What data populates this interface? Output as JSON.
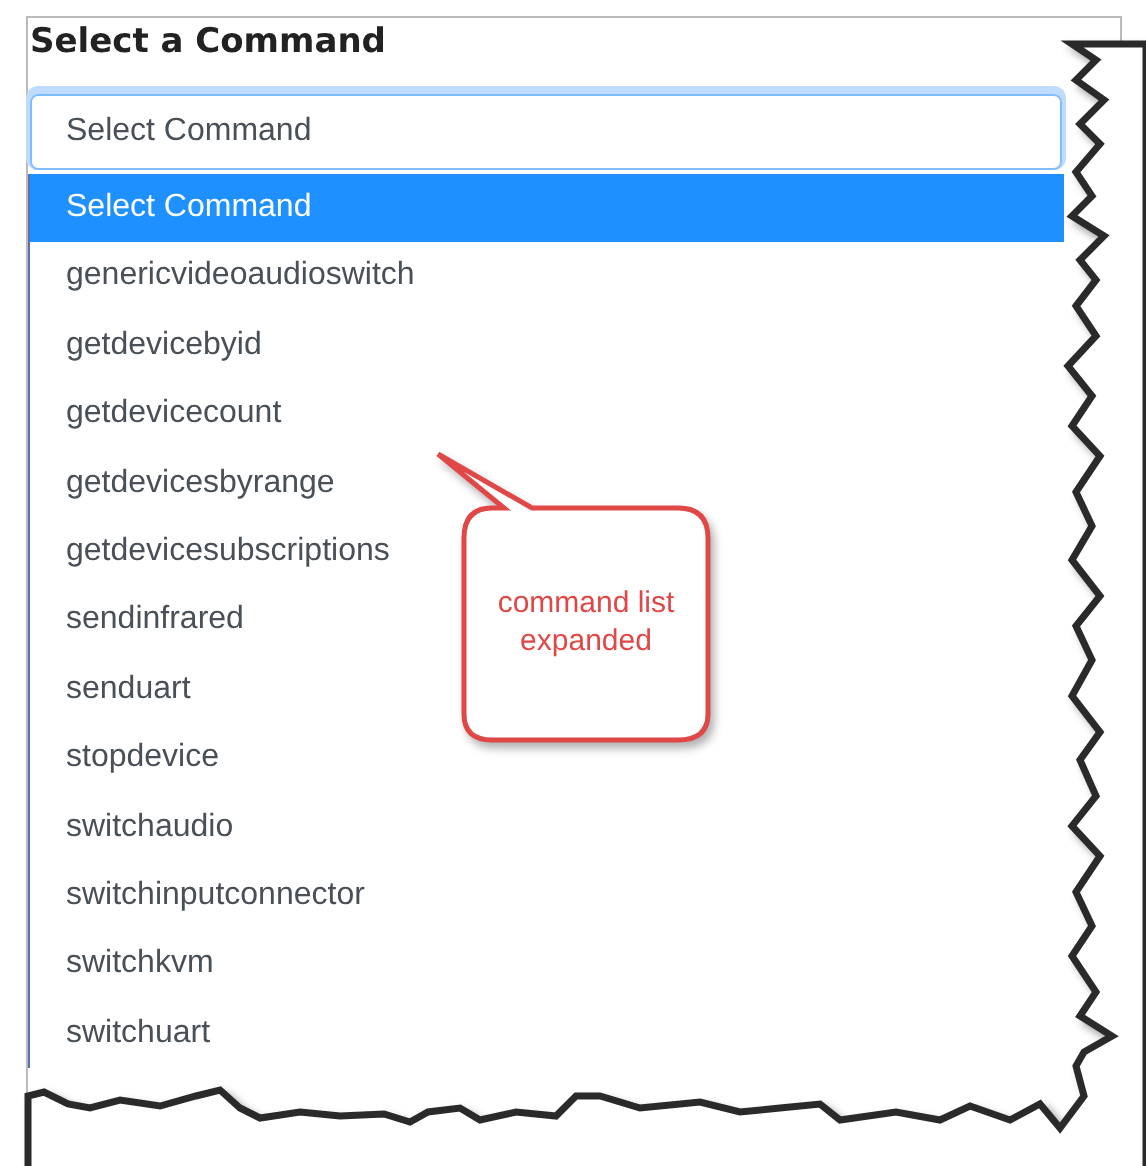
{
  "title": "Select a Command",
  "select": {
    "value": "Select Command",
    "expanded": true
  },
  "options": [
    {
      "label": "Select Command",
      "selected": true
    },
    {
      "label": "genericvideoaudioswitch",
      "selected": false
    },
    {
      "label": "getdevicebyid",
      "selected": false
    },
    {
      "label": "getdevicecount",
      "selected": false
    },
    {
      "label": "getdevicesbyrange",
      "selected": false
    },
    {
      "label": "getdevicesubscriptions",
      "selected": false
    },
    {
      "label": "sendinfrared",
      "selected": false
    },
    {
      "label": "senduart",
      "selected": false
    },
    {
      "label": "stopdevice",
      "selected": false
    },
    {
      "label": "switchaudio",
      "selected": false
    },
    {
      "label": "switchinputconnector",
      "selected": false
    },
    {
      "label": "switchkvm",
      "selected": false
    },
    {
      "label": "switchuart",
      "selected": false
    }
  ],
  "callout": {
    "text": "command list expanded"
  }
}
